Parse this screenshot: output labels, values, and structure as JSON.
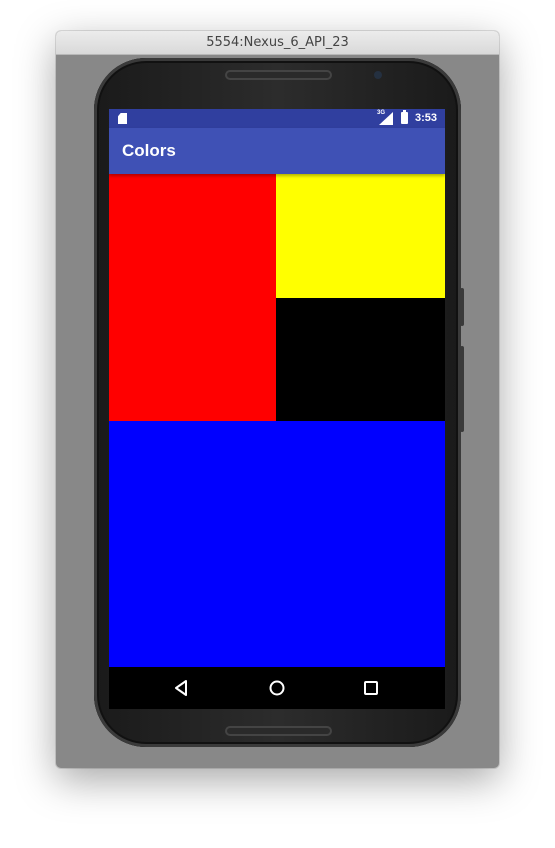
{
  "window": {
    "title": "5554:Nexus_6_API_23"
  },
  "statusbar": {
    "network_label": "3G",
    "time": "3:53",
    "icons": [
      "sd-card-icon",
      "mobile-signal-icon",
      "battery-charging-icon"
    ]
  },
  "appbar": {
    "title": "Colors"
  },
  "blocks": [
    {
      "name": "red-block",
      "color": "#ff0000"
    },
    {
      "name": "yellow-block",
      "color": "#ffff00"
    },
    {
      "name": "black-block",
      "color": "#000000"
    },
    {
      "name": "blue-block",
      "color": "#0000ff"
    }
  ],
  "navbar": {
    "buttons": [
      "back-icon",
      "home-icon",
      "recents-icon"
    ]
  },
  "colors": {
    "statusbar": "#303f9f",
    "appbar": "#3f51b5"
  }
}
